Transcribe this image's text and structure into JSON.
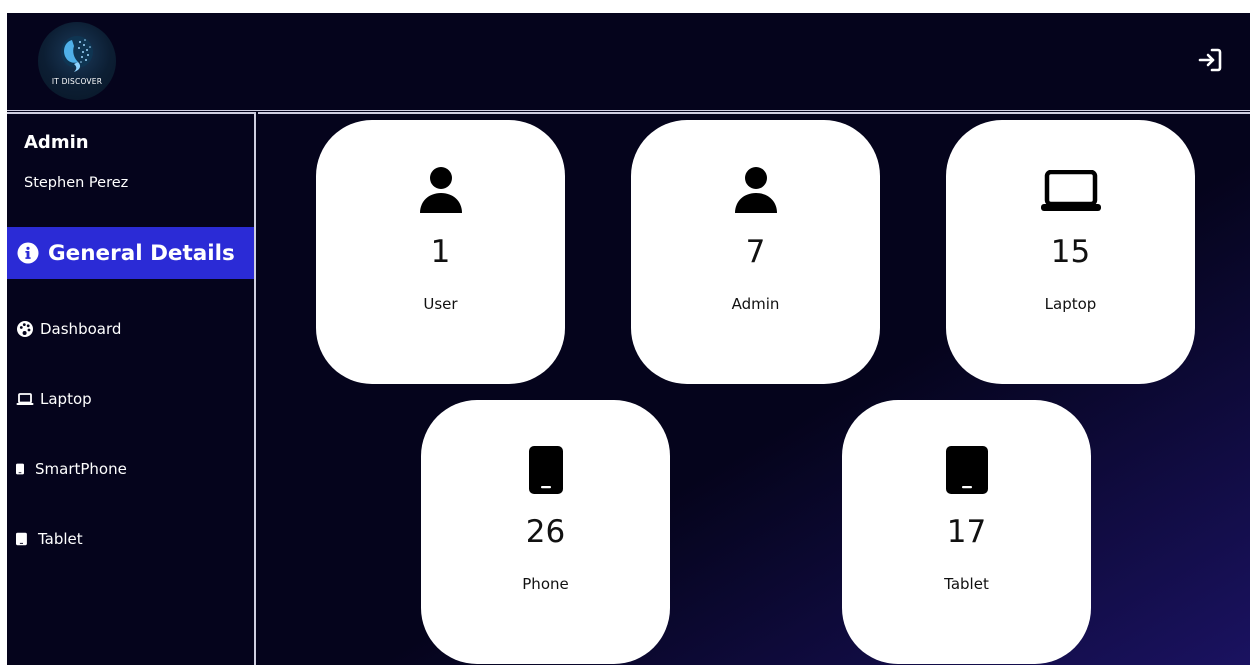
{
  "header": {
    "logo_text": "IT DISCOVER",
    "logout_icon": "logout-icon"
  },
  "sidebar": {
    "role": "Admin",
    "user_name": "Stephen Perez",
    "active_item": {
      "label": "General Details",
      "icon": "info-circle-icon"
    },
    "items": [
      {
        "label": "Dashboard",
        "icon": "palette-icon"
      },
      {
        "label": "Laptop",
        "icon": "laptop-icon"
      },
      {
        "label": "SmartPhone",
        "icon": "smartphone-icon"
      },
      {
        "label": "Tablet",
        "icon": "tablet-icon"
      }
    ]
  },
  "cards": [
    {
      "count": "1",
      "label": "User",
      "icon": "user-icon"
    },
    {
      "count": "7",
      "label": "Admin",
      "icon": "user-icon"
    },
    {
      "count": "15",
      "label": "Laptop",
      "icon": "laptop-icon"
    },
    {
      "count": "26",
      "label": "Phone",
      "icon": "phone-icon"
    },
    {
      "count": "17",
      "label": "Tablet",
      "icon": "tablet-icon"
    }
  ],
  "colors": {
    "background": "#05041c",
    "active_nav": "#2b2bd6",
    "card": "#ffffff"
  }
}
